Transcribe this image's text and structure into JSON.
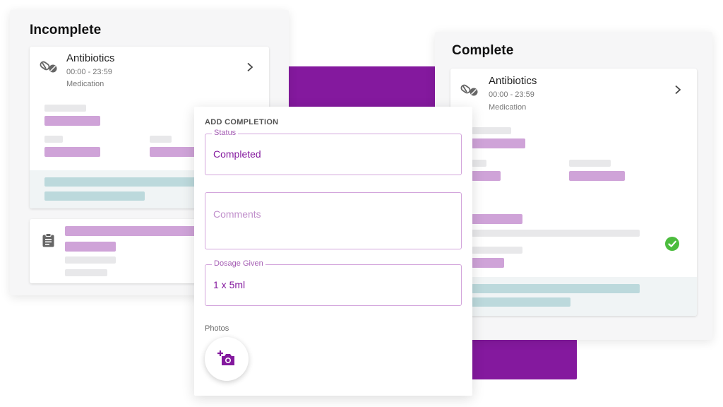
{
  "incomplete": {
    "title": "Incomplete",
    "card": {
      "icon": "pills-icon",
      "name": "Antibiotics",
      "time": "00:00 - 23:59",
      "type": "Medication",
      "chevron": "chevron-right-icon"
    },
    "second_card_icon": "clipboard-icon"
  },
  "complete": {
    "title": "Complete",
    "card": {
      "icon": "pills-icon",
      "name": "Antibiotics",
      "time": "00:00 - 23:59",
      "type": "Medication",
      "chevron": "chevron-right-icon"
    },
    "status_icon": "check-circle-icon"
  },
  "form": {
    "title": "ADD COMPLETION",
    "status": {
      "label": "Status",
      "value": "Completed"
    },
    "comments": {
      "placeholder": "Comments"
    },
    "dosage": {
      "label": "Dosage Given",
      "value": "1 x 5ml"
    },
    "photos_label": "Photos",
    "photo_button_icon": "add-photo-icon"
  },
  "colors": {
    "accent": "#84199e",
    "placeholder_purple": "#cfa3d8",
    "placeholder_gray": "#e8e8ea",
    "placeholder_teal": "#bcd9dc",
    "success": "#4cbc3e"
  }
}
